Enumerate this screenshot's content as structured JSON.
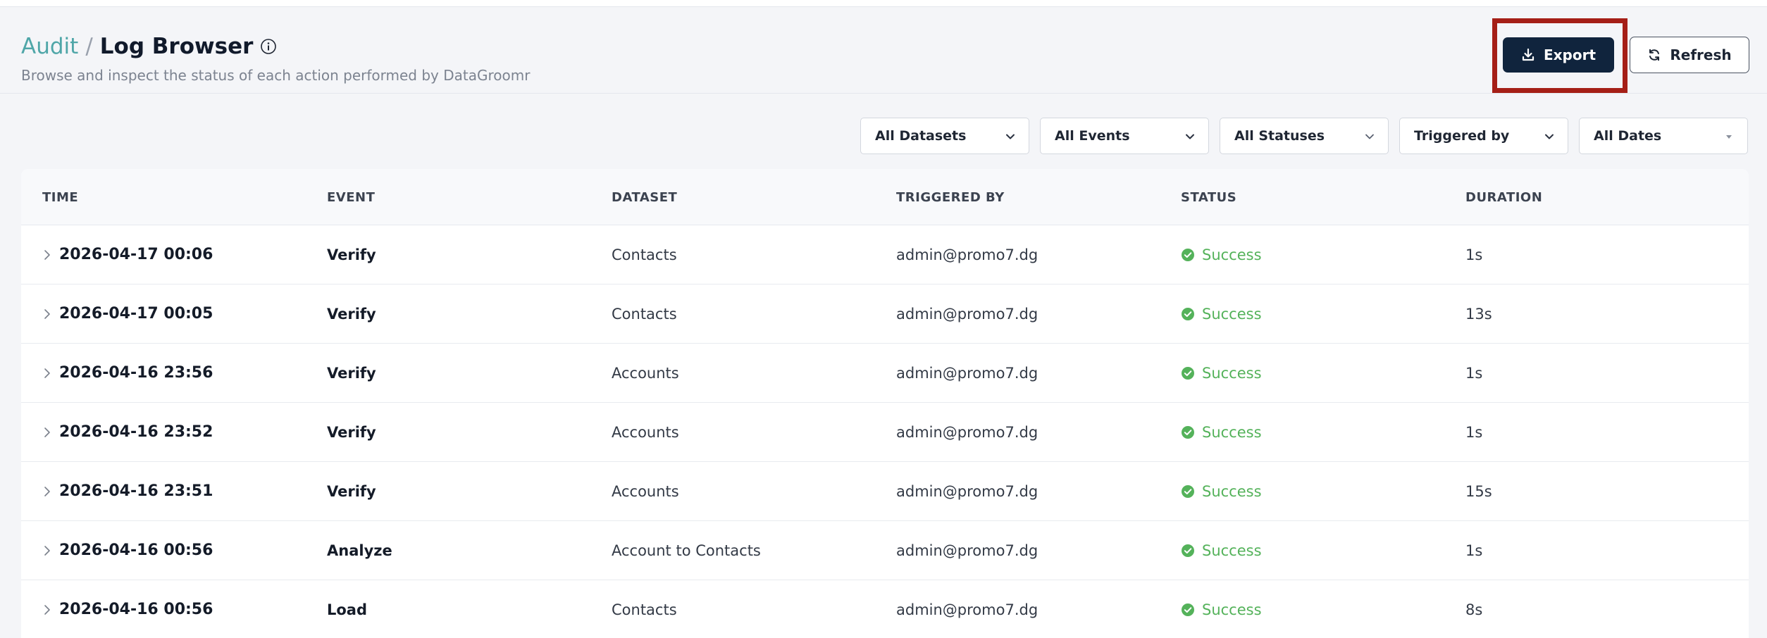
{
  "header": {
    "breadcrumb_parent": "Audit",
    "breadcrumb_separator": "/",
    "title": "Log Browser",
    "subtitle": "Browse and inspect the status of each action performed by DataGroomr"
  },
  "toolbar": {
    "export_label": "Export",
    "refresh_label": "Refresh"
  },
  "filters": [
    {
      "label": "All Datasets"
    },
    {
      "label": "All Events"
    },
    {
      "label": "All Statuses"
    },
    {
      "label": "Triggered by"
    },
    {
      "label": "All Dates"
    }
  ],
  "table": {
    "columns": [
      "TIME",
      "EVENT",
      "DATASET",
      "TRIGGERED BY",
      "STATUS",
      "DURATION"
    ],
    "rows": [
      {
        "time": "2026-04-17 00:06",
        "event": "Verify",
        "dataset": "Contacts",
        "triggered_by": "admin@promo7.dg",
        "status": "Success",
        "duration": "1s"
      },
      {
        "time": "2026-04-17 00:05",
        "event": "Verify",
        "dataset": "Contacts",
        "triggered_by": "admin@promo7.dg",
        "status": "Success",
        "duration": "13s"
      },
      {
        "time": "2026-04-16 23:56",
        "event": "Verify",
        "dataset": "Accounts",
        "triggered_by": "admin@promo7.dg",
        "status": "Success",
        "duration": "1s"
      },
      {
        "time": "2026-04-16 23:52",
        "event": "Verify",
        "dataset": "Accounts",
        "triggered_by": "admin@promo7.dg",
        "status": "Success",
        "duration": "1s"
      },
      {
        "time": "2026-04-16 23:51",
        "event": "Verify",
        "dataset": "Accounts",
        "triggered_by": "admin@promo7.dg",
        "status": "Success",
        "duration": "15s"
      },
      {
        "time": "2026-04-16 00:56",
        "event": "Analyze",
        "dataset": "Account to Contacts",
        "triggered_by": "admin@promo7.dg",
        "status": "Success",
        "duration": "1s"
      },
      {
        "time": "2026-04-16 00:56",
        "event": "Load",
        "dataset": "Contacts",
        "triggered_by": "admin@promo7.dg",
        "status": "Success",
        "duration": "8s"
      }
    ]
  },
  "colors": {
    "accent": "#4fa6a8",
    "primary_button": "#10243d",
    "success": "#54b25a",
    "highlight_box": "#a51f17"
  },
  "icons": {
    "info": "info-icon",
    "export": "download-icon",
    "refresh": "refresh-icon",
    "filter_dropdown": "chevron-down-icon",
    "row_expand": "chevron-right-icon",
    "status_success": "check-circle-icon"
  }
}
